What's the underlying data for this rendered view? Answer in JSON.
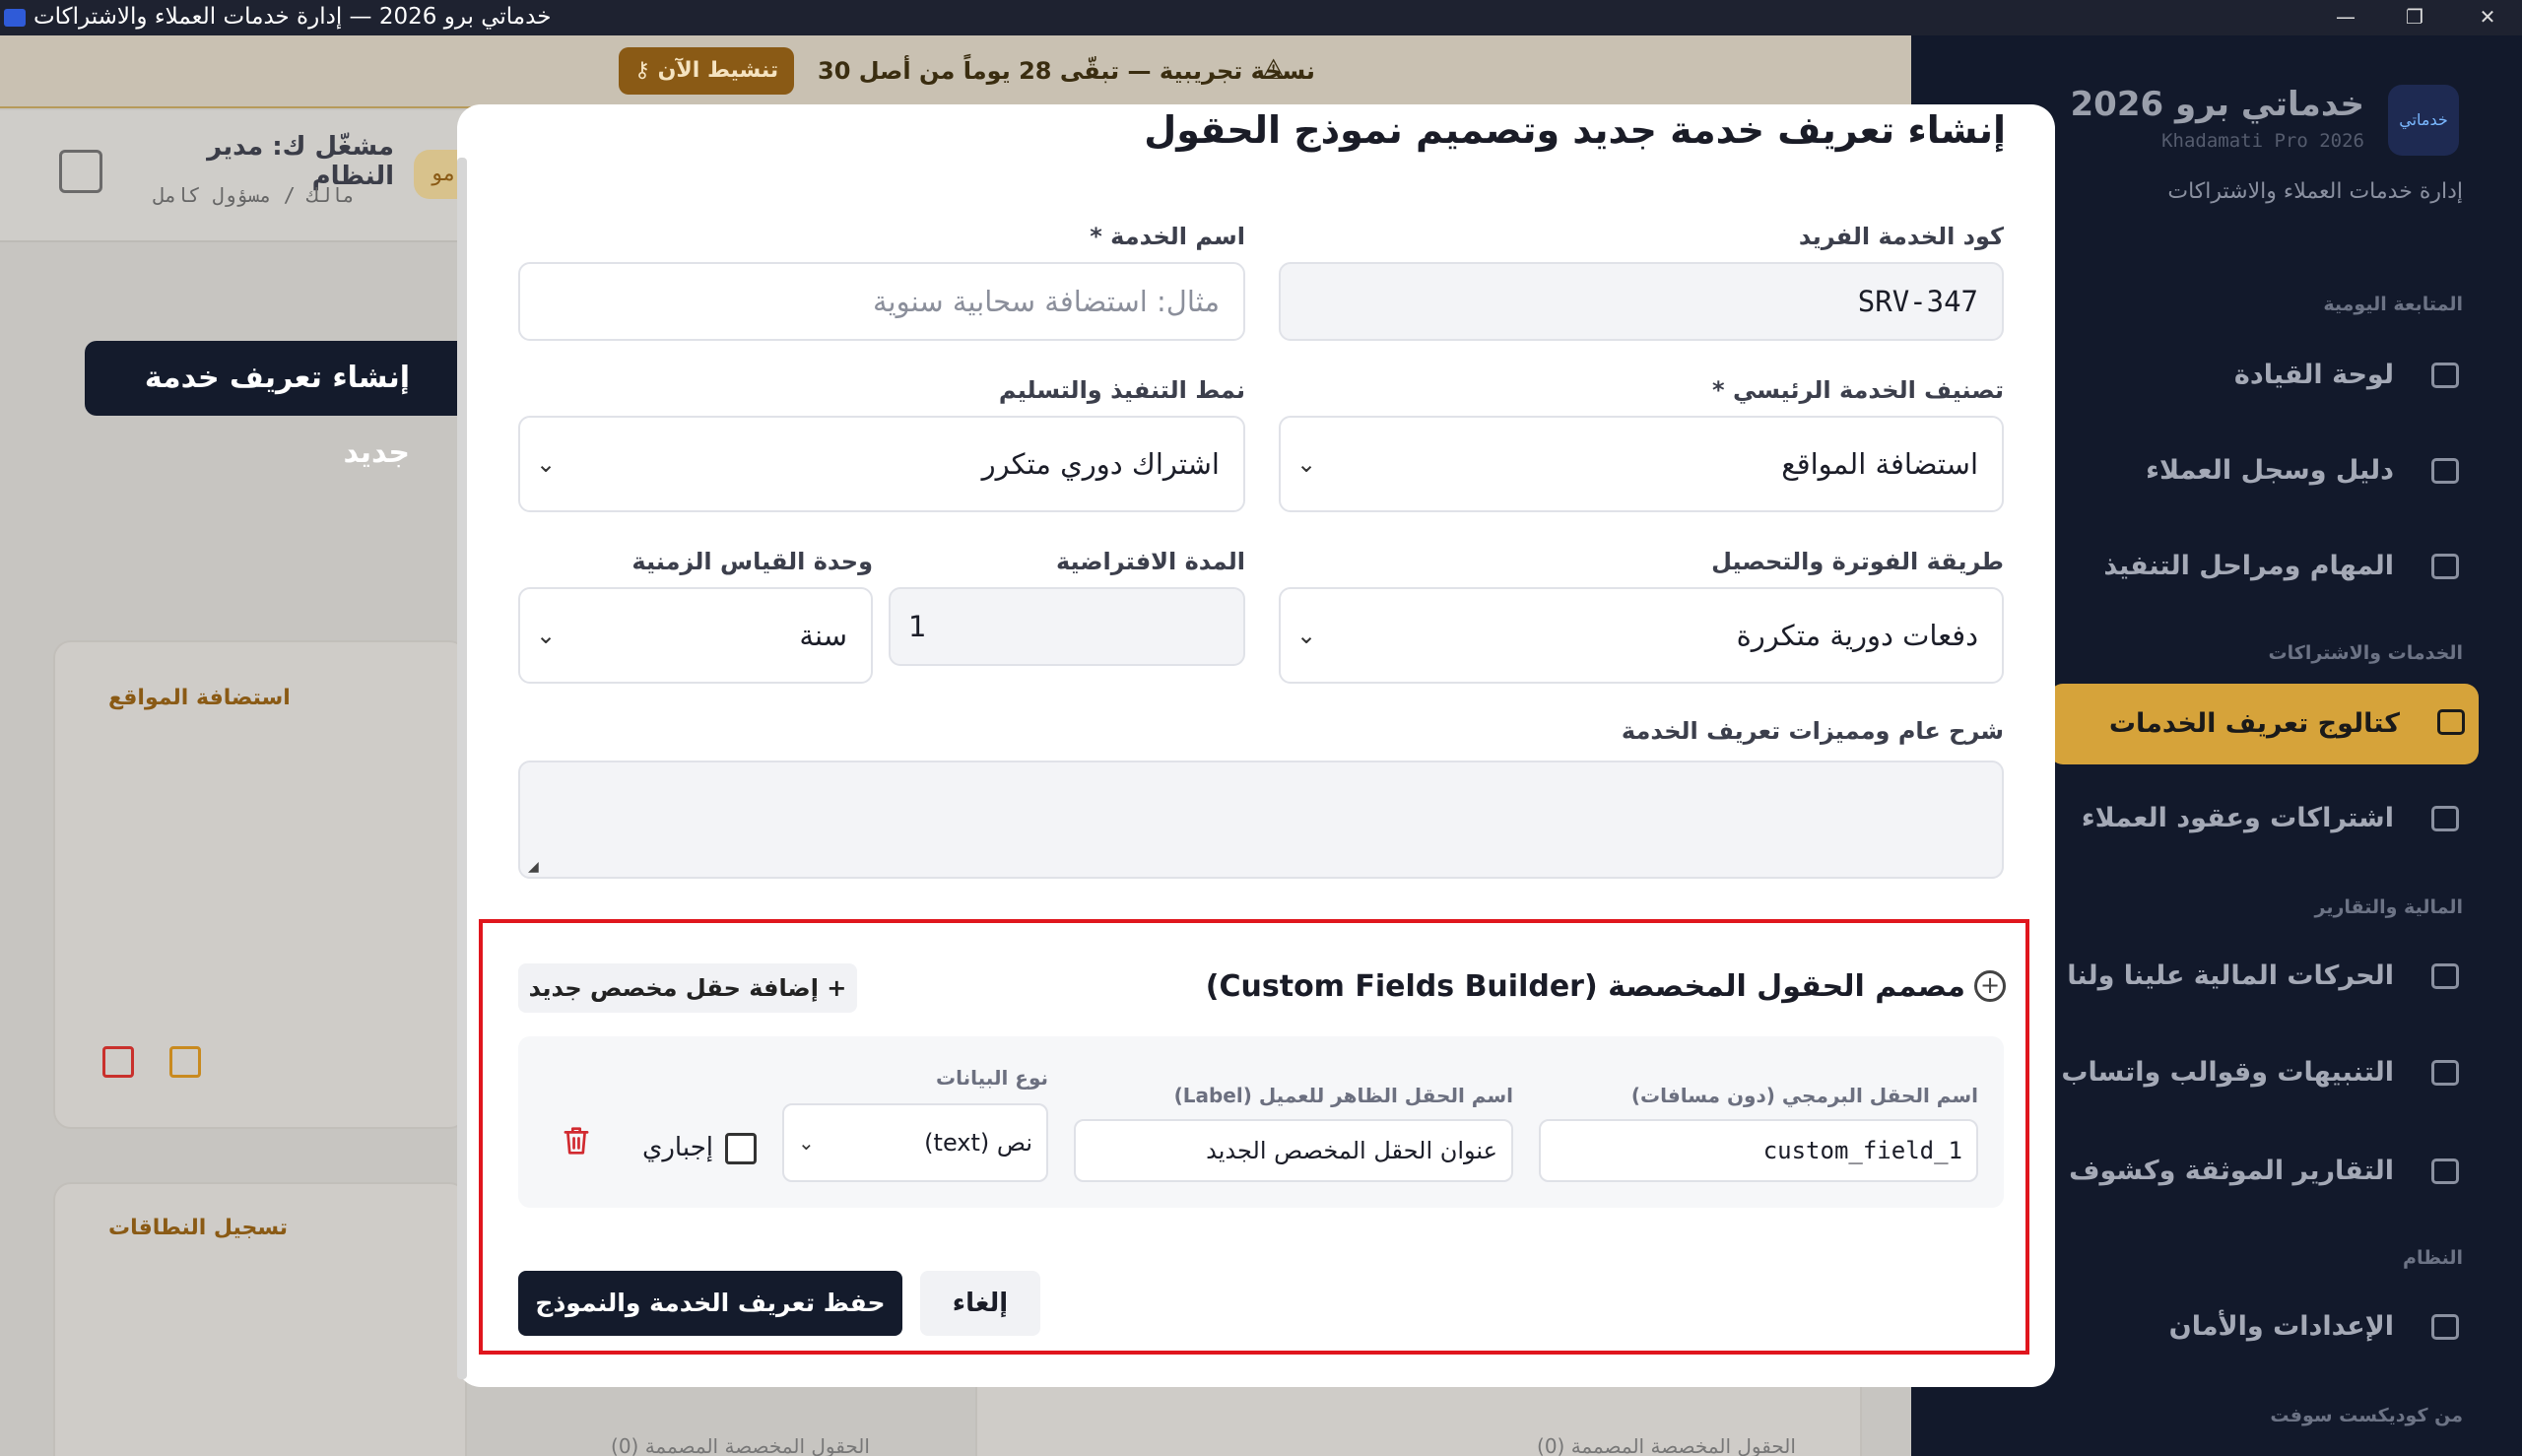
{
  "window": {
    "title": "خدماتي برو 2026 — إدارة خدمات العملاء والاشتراكات",
    "minimize": "—",
    "maximize": "❐",
    "close": "✕"
  },
  "trial_banner": {
    "text": "نسخة تجريبية — تبقّى 28 يوماً من أصل 30",
    "activate_label": "تنشيط الآن"
  },
  "user": {
    "name": "مشغّل ك: مدير النظام",
    "role": "مالك / مسؤول كامل",
    "chip": "مو"
  },
  "background": {
    "create_button": "إنشاء تعريف خدمة جديد",
    "cards": [
      {
        "tag": "استضافة المواقع"
      },
      {
        "tag": "تسجيل النطاقات"
      }
    ],
    "footer_note_1": "الحقول المخصصة المصممة (0)",
    "footer_note_2": "الحقول المخصصة المصممة (0)"
  },
  "sidebar": {
    "logo": "خدماتي",
    "title": "خدماتي برو 2026",
    "subtitle": "Khadamati Pro 2026",
    "description": "إدارة خدمات العملاء والاشتراكات",
    "sections": {
      "daily": "المتابعة اليومية",
      "services": "الخدمات والاشتراكات",
      "finance": "المالية والتقارير",
      "system": "النظام",
      "vendor": "من كوديكست سوفت"
    },
    "items": [
      {
        "label": "لوحة القيادة",
        "icon": "dashboard-icon"
      },
      {
        "label": "دليل وسجل العملاء",
        "icon": "users-icon"
      },
      {
        "label": "المهام ومراحل التنفيذ",
        "icon": "briefcase-icon"
      },
      {
        "label": "كتالوج تعريف الخدمات",
        "icon": "layers-icon"
      },
      {
        "label": "اشتراكات وعقود العملاء",
        "icon": "calendar-check-icon"
      },
      {
        "label": "الحركات المالية علينا ولنا",
        "icon": "credit-card-icon"
      },
      {
        "label": "التنبيهات وقوالب واتساب",
        "icon": "send-icon"
      },
      {
        "label": "التقارير الموثقة وكشوف الحسابات",
        "icon": "file-chart-icon"
      },
      {
        "label": "الإعدادات والأمان",
        "icon": "gear-icon"
      }
    ]
  },
  "modal": {
    "title": "إنشاء تعريف خدمة جديد وتصميم نموذج الحقول",
    "fields": {
      "service_code": {
        "label": "كود الخدمة الفريد",
        "value": "SRV-347"
      },
      "service_name": {
        "label": "اسم الخدمة *",
        "placeholder": "مثال: استضافة سحابية سنوية"
      },
      "category": {
        "label": "تصنيف الخدمة الرئيسي *",
        "value": "استضافة المواقع"
      },
      "delivery_mode": {
        "label": "نمط التنفيذ والتسليم",
        "value": "اشتراك دوري متكرر"
      },
      "billing_method": {
        "label": "طريقة الفوترة والتحصيل",
        "value": "دفعات دورية متكررة"
      },
      "default_duration": {
        "label": "المدة الافتراضية",
        "value": "1"
      },
      "time_unit": {
        "label": "وحدة القياس الزمنية",
        "value": "سنة"
      },
      "description": {
        "label": "شرح عام ومميزات تعريف الخدمة",
        "value": ""
      }
    },
    "custom_fields": {
      "title": "مصمم الحقول المخصصة (Custom Fields Builder)",
      "add_button": "+ إضافة حقل مخصص جديد",
      "rows": [
        {
          "key_label": "اسم الحقل البرمجي (دون مسافات)",
          "key_value": "custom_field_1",
          "display_label": "اسم الحقل الظاهر للعميل (Label)",
          "display_value": "عنوان الحقل المخصص الجديد",
          "type_label": "نوع البيانات",
          "type_value": "نص (text)",
          "required_label": "إجباري",
          "required": false
        }
      ]
    },
    "save_button": "حفظ تعريف الخدمة والنموذج",
    "cancel_button": "إلغاء"
  }
}
